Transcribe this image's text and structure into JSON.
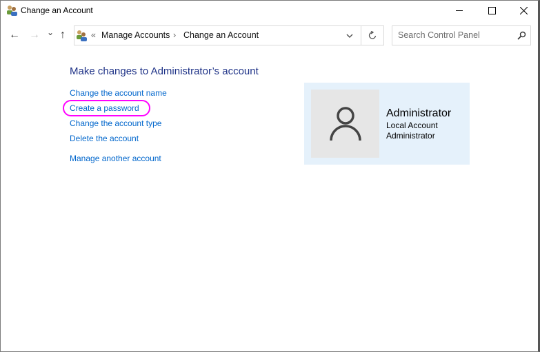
{
  "window": {
    "title": "Change an Account",
    "icon": "users-icon"
  },
  "nav": {
    "back": "←",
    "forward": "→",
    "recent": "⌄",
    "up": "↑"
  },
  "address": {
    "overflow": "«",
    "crumbs": [
      "Manage Accounts",
      "Change an Account"
    ],
    "separator": "›"
  },
  "search": {
    "placeholder": "Search Control Panel"
  },
  "main": {
    "heading": "Make changes to Administrator’s account",
    "links": [
      "Change the account name",
      "Create a password",
      "Change the account type",
      "Delete the account"
    ],
    "other_link": "Manage another account"
  },
  "account": {
    "name": "Administrator",
    "type": "Local Account",
    "role": "Administrator"
  },
  "colors": {
    "link": "#0066cc",
    "heading": "#1e3287",
    "card": "#e5f1fb",
    "highlight": "#ff00ff"
  }
}
